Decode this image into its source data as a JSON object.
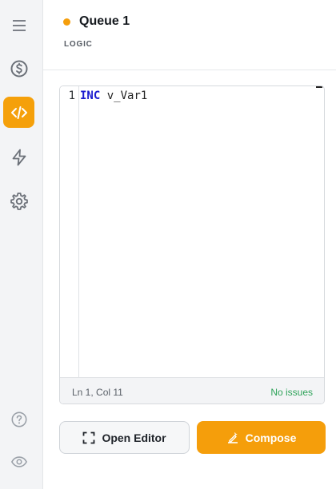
{
  "sidebar": {
    "items": [
      {
        "icon": "menu-icon",
        "active": false
      },
      {
        "icon": "dollar-icon",
        "active": false
      },
      {
        "icon": "code-icon",
        "active": true
      },
      {
        "icon": "lightning-icon",
        "active": false
      },
      {
        "icon": "gear-icon",
        "active": false
      }
    ],
    "bottom_items": [
      {
        "icon": "help-icon"
      },
      {
        "icon": "eye-icon"
      }
    ],
    "accent_color": "#f5a00a"
  },
  "header": {
    "title": "Queue 1",
    "subtitle": "LOGIC",
    "status_color": "#f59e0b"
  },
  "editor": {
    "lines": [
      {
        "number": "1",
        "keyword": "INC",
        "rest": " v_Var1"
      }
    ],
    "status_position": "Ln 1, Col 11",
    "status_issues": "No issues"
  },
  "actions": {
    "open_editor_label": "Open Editor",
    "compose_label": "Compose"
  }
}
